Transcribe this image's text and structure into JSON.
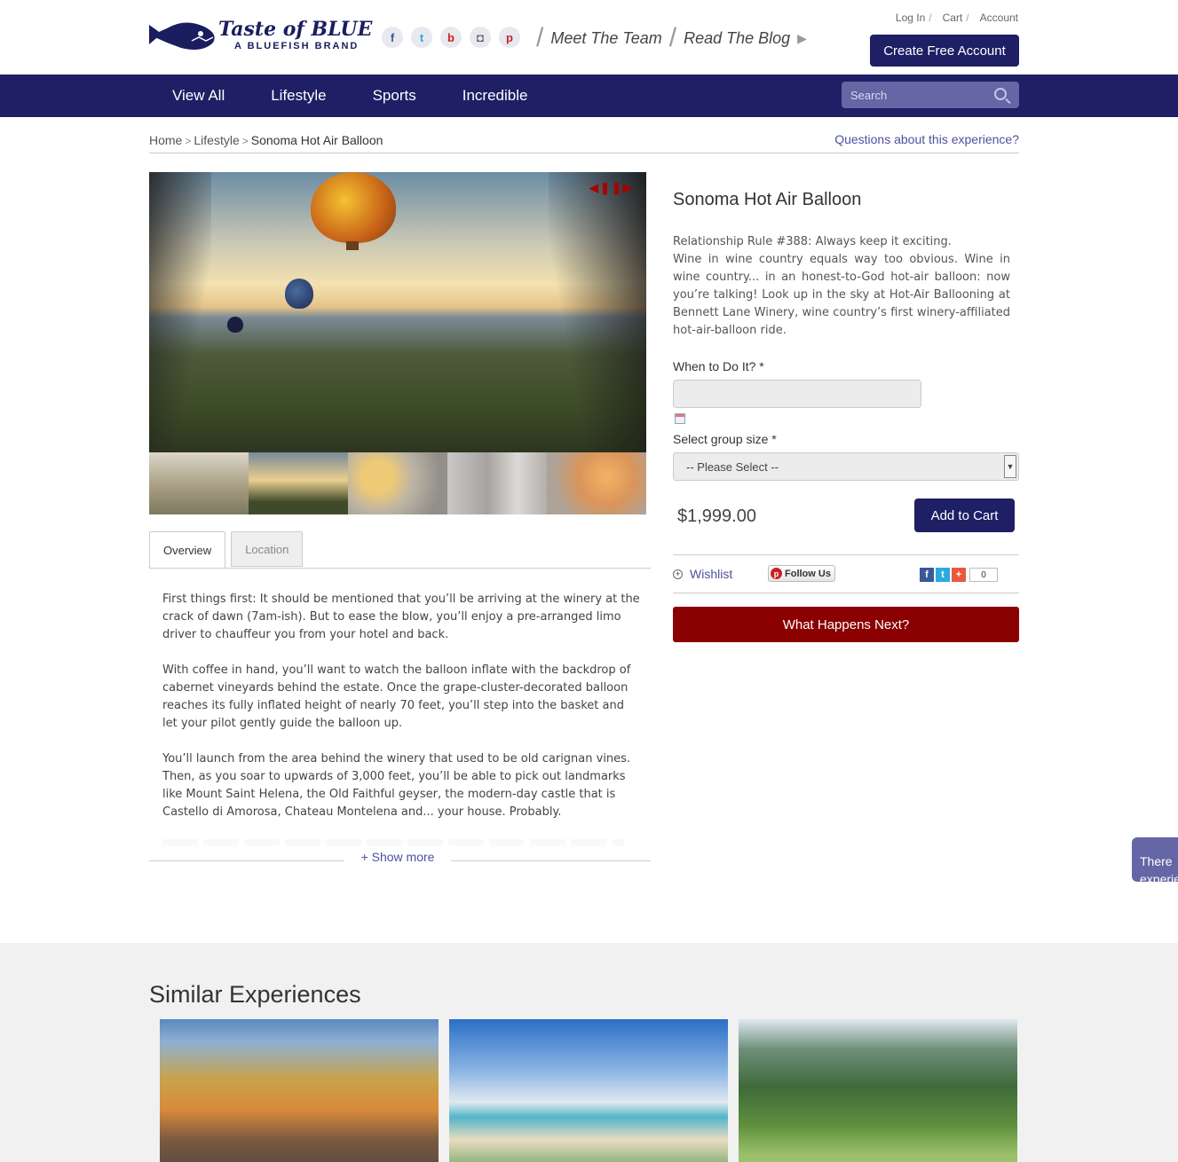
{
  "header": {
    "brand": "Taste of BLUE",
    "brand_sub": "A BLUEFISH BRAND",
    "social_icons": [
      "facebook-icon",
      "twitter-icon",
      "blog-icon",
      "instagram-icon",
      "pinterest-icon"
    ],
    "meet_team": "Meet The Team",
    "read_blog": "Read The Blog",
    "login": "Log In",
    "cart": "Cart",
    "account": "Account",
    "create_account": "Create Free Account"
  },
  "nav": {
    "items": [
      "View All",
      "Lifestyle",
      "Sports",
      "Incredible"
    ],
    "search_placeholder": "Search"
  },
  "breadcrumb": {
    "home": "Home",
    "category": "Lifestyle",
    "current": "Sonoma Hot Air Balloon",
    "questions": "Questions about this experience?"
  },
  "tabs": [
    "Overview",
    "Location"
  ],
  "description": [
    "First things first: It should be mentioned that you’ll be arriving at the winery at the crack of dawn (7am-ish). But to ease the blow, you’ll enjoy a pre-arranged  limo driver to chauffeur you from your hotel and back.",
    "With coffee in hand, you’ll want to watch the balloon inflate with the backdrop of cabernet vineyards behind the estate. Once the grape-cluster-decorated balloon reaches its fully inflated height of nearly 70 feet, you’ll step into the basket and let your pilot gently guide the balloon up.",
    "You’ll launch from the area behind the winery that used to be old carignan vines. Then, as you soar to upwards of 3,000 feet, you’ll be able to pick out landmarks like Mount Saint Helena, the Old Faithful geyser, the modern-day castle that is Castello di Amorosa, Chateau Montelena and... your house. Probably."
  ],
  "show_more": "+ Show more",
  "product": {
    "title": "Sonoma Hot Air Balloon",
    "rule": "Relationship Rule #388: Always keep it exciting.",
    "blurb": "Wine in wine country equals way too obvious. Wine in wine country... in an honest-to-God hot-air balloon: now you’re talking! Look up in the sky at Hot-Air Ballooning at Bennett Lane Winery, wine country’s first winery-affiliated hot-air-balloon ride.",
    "when_label": "When to Do It? *",
    "date_value": "",
    "group_label": "Select group size *",
    "group_selected": "-- Please Select --",
    "price": "$1,999.00",
    "add_to_cart": "Add to Cart",
    "wishlist": "Wishlist",
    "follow_us": "Follow Us",
    "share_count": "0",
    "what_next": "What Happens Next?"
  },
  "side_tab": "There experie",
  "similar": {
    "heading": "Similar Experiences"
  },
  "colors": {
    "navy": "#1e1f65",
    "accent_link": "#4f50a0",
    "red_button": "#8b0000"
  }
}
